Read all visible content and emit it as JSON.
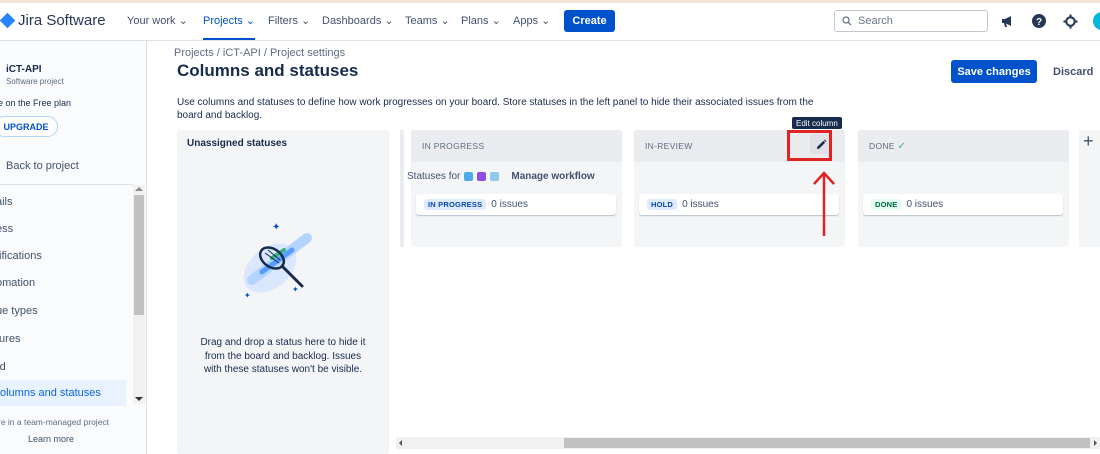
{
  "topbar": {
    "product": "Jira Software",
    "nav": [
      "Your work",
      "Projects",
      "Filters",
      "Dashboards",
      "Teams",
      "Plans",
      "Apps"
    ],
    "create_label": "Create",
    "search_placeholder": "Search"
  },
  "sidebar": {
    "project_name": "iCT-API",
    "project_type": "Software project",
    "plan_text": "e on the Free plan",
    "upgrade_label": "UPGRADE",
    "back_label": "Back to project",
    "items": [
      "ails",
      "ess",
      "tifications",
      "omation",
      "ue types",
      "tures",
      "rd",
      "olumns and statuses"
    ],
    "footer_text": "re in a team-managed project",
    "learn_more": "Learn more"
  },
  "main": {
    "breadcrumb": "Projects  /  iCT-API  /  Project settings",
    "title": "Columns and statuses",
    "save_label": "Save changes",
    "discard_label": "Discard",
    "description": "Use columns and statuses to define how work progresses on your board. Store statuses in the left panel to hide their associated issues from the board and backlog.",
    "unassigned_title": "Unassigned statuses",
    "unassigned_hint": "Drag and drop a status here to hide it from the board and backlog. Issues with these statuses won't be visible.",
    "statuses_for": "Statuses for",
    "manage_workflow": "Manage workflow",
    "edit_tooltip": "Edit column",
    "columns": [
      {
        "name": "IN PROGRESS",
        "status": "IN PROGRESS",
        "count": "0 issues"
      },
      {
        "name": "IN-REVIEW",
        "status": "HOLD",
        "count": "0 issues"
      },
      {
        "name": "DONE",
        "status": "DONE",
        "count": "0 issues"
      }
    ]
  },
  "colors": {
    "brand_blue": "#0052cc",
    "highlight_red": "#e02424",
    "done_green": "#006644",
    "lozenge_blue_bg": "#deebff",
    "lozenge_green_bg": "#e3fcef"
  },
  "icons": [
    "jira-logo-icon",
    "search-icon",
    "megaphone-icon",
    "help-icon",
    "gear-icon",
    "edit-pencil-icon",
    "check-icon",
    "plus-icon",
    "arrow-up-icon"
  ]
}
